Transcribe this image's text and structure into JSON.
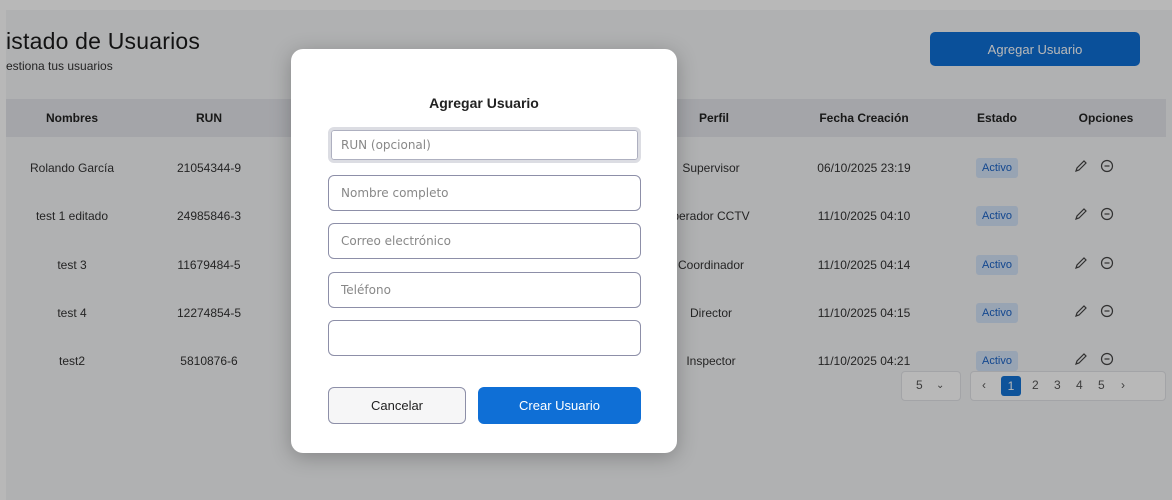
{
  "header": {
    "title": "istado de Usuarios",
    "subtitle": "estiona tus usuarios",
    "add_button": "Agregar Usuario"
  },
  "table": {
    "columns": [
      "Nombres",
      "RUN",
      "Perfil",
      "Fecha Creación",
      "Estado",
      "Opciones"
    ],
    "rows": [
      {
        "nombre": "Rolando García",
        "run": "21054344-9",
        "perfil": "Supervisor",
        "fecha": "06/10/2025 23:19",
        "estado": "Activo"
      },
      {
        "nombre": "test 1 editado",
        "run": "24985846-3",
        "perfil": "perador CCTV",
        "fecha": "11/10/2025 04:10",
        "estado": "Activo"
      },
      {
        "nombre": "test 3",
        "run": "11679484-5",
        "perfil": "Coordinador",
        "fecha": "11/10/2025 04:14",
        "estado": "Activo"
      },
      {
        "nombre": "test 4",
        "run": "12274854-5",
        "perfil": "Director",
        "fecha": "11/10/2025 04:15",
        "estado": "Activo"
      },
      {
        "nombre": "test2",
        "run": "5810876-6",
        "perfil": "Inspector",
        "fecha": "11/10/2025 04:21",
        "estado": "Activo"
      }
    ],
    "icons": {
      "edit": "pencil-icon",
      "disable": "minus-circle-icon"
    }
  },
  "pagination": {
    "page_size": "5",
    "pages": [
      "1",
      "2",
      "3",
      "4",
      "5"
    ],
    "current_page": "1"
  },
  "modal": {
    "title": "Agregar Usuario",
    "fields": [
      {
        "placeholder": "RUN (opcional)",
        "value": ""
      },
      {
        "placeholder": "Nombre completo",
        "value": ""
      },
      {
        "placeholder": "Correo electrónico",
        "value": ""
      },
      {
        "placeholder": "Teléfono",
        "value": ""
      },
      {
        "placeholder": "",
        "value": ""
      }
    ],
    "cancel_label": "Cancelar",
    "create_label": "Crear Usuario"
  },
  "colors": {
    "primary": "#0f6fd6",
    "badge_bg": "#d3e3f8",
    "badge_text": "#1a63c7"
  }
}
